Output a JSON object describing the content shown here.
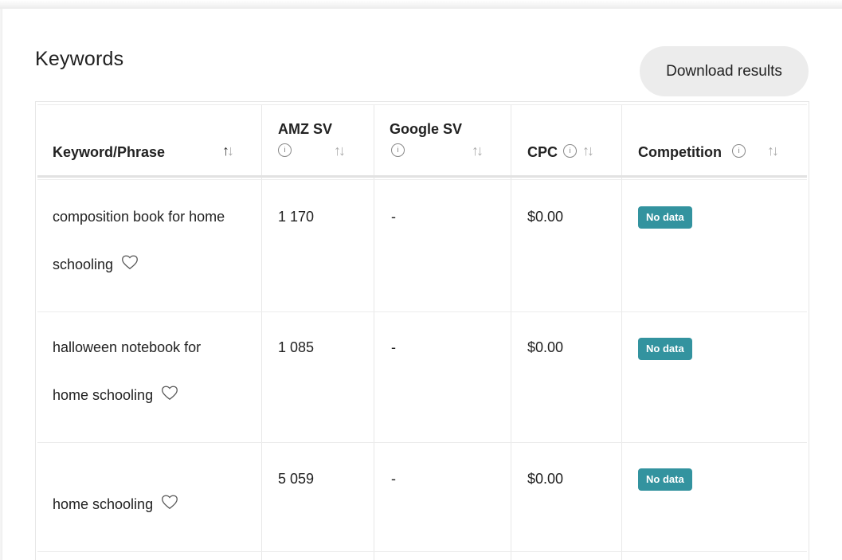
{
  "page": {
    "title": "Keywords",
    "download_button": "Download results"
  },
  "table": {
    "columns": [
      {
        "label": "Keyword/Phrase",
        "info": false,
        "sort": "ascending"
      },
      {
        "label": "AMZ SV",
        "info": true,
        "sort": "none"
      },
      {
        "label": "Google SV",
        "info": true,
        "sort": "none"
      },
      {
        "label": "CPC",
        "info": true,
        "sort": "none"
      },
      {
        "label": "Competition",
        "info": true,
        "sort": "none"
      }
    ],
    "sort_icon": "↑↓",
    "info_icon": "info-icon",
    "rows": [
      {
        "keyword_line1": "composition book for home",
        "keyword_line2": "schooling",
        "amz_sv": "1 170",
        "google_sv": "-",
        "cpc": "$0.00",
        "competition": "No data"
      },
      {
        "keyword_line1": "halloween notebook for",
        "keyword_line2": "home schooling",
        "amz_sv": "1 085",
        "google_sv": "-",
        "cpc": "$0.00",
        "competition": "No data"
      },
      {
        "keyword_line1": "",
        "keyword_line2": "home schooling",
        "amz_sv": "5 059",
        "google_sv": "-",
        "cpc": "$0.00",
        "competition": "No data"
      }
    ]
  },
  "colors": {
    "badge": "#33939f",
    "button_bg": "#ececec"
  }
}
